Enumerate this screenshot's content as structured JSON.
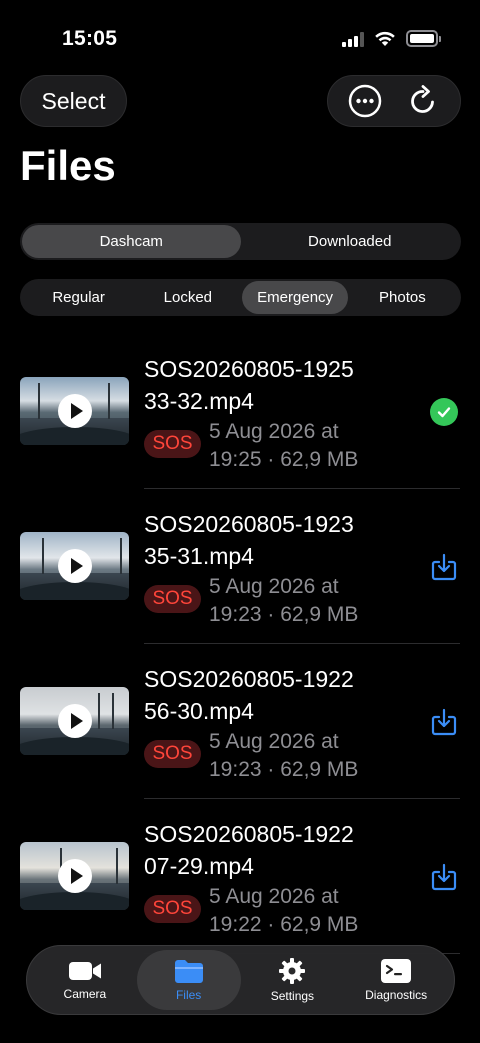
{
  "status_bar": {
    "time": "15:05"
  },
  "header": {
    "select_label": "Select",
    "more_icon": "ellipsis-circle-icon",
    "refresh_icon": "refresh-icon",
    "title": "Files"
  },
  "segment": {
    "tabs": [
      {
        "label": "Dashcam",
        "active": true
      },
      {
        "label": "Downloaded",
        "active": false
      }
    ]
  },
  "filters": {
    "items": [
      {
        "label": "Regular",
        "active": false
      },
      {
        "label": "Locked",
        "active": false
      },
      {
        "label": "Emergency",
        "active": true
      },
      {
        "label": "Photos",
        "active": false
      }
    ]
  },
  "files": [
    {
      "name_line1": "SOS20260805-1925",
      "name_line2": "33-32.mp4",
      "badge": "SOS",
      "date": "5 Aug 2026 at",
      "time_size": "19:25 · 62,9 MB",
      "status": "downloaded"
    },
    {
      "name_line1": "SOS20260805-1923",
      "name_line2": "35-31.mp4",
      "badge": "SOS",
      "date": "5 Aug 2026 at",
      "time_size": "19:23 · 62,9 MB",
      "status": "download"
    },
    {
      "name_line1": "SOS20260805-1922",
      "name_line2": "56-30.mp4",
      "badge": "SOS",
      "date": "5 Aug 2026 at",
      "time_size": "19:23 · 62,9 MB",
      "status": "download"
    },
    {
      "name_line1": "SOS20260805-1922",
      "name_line2": "07-29.mp4",
      "badge": "SOS",
      "date": "5 Aug 2026 at",
      "time_size": "19:22 · 62,9 MB",
      "status": "download"
    }
  ],
  "tab_bar": {
    "tabs": [
      {
        "label": "Camera",
        "icon": "video-camera-icon",
        "active": false
      },
      {
        "label": "Files",
        "icon": "folder-icon",
        "active": true
      },
      {
        "label": "Settings",
        "icon": "gear-icon",
        "active": false
      },
      {
        "label": "Diagnostics",
        "icon": "terminal-icon",
        "active": false
      }
    ]
  },
  "colors": {
    "accent": "#3b8df6",
    "success": "#34c759",
    "sos": "#ff453a"
  }
}
